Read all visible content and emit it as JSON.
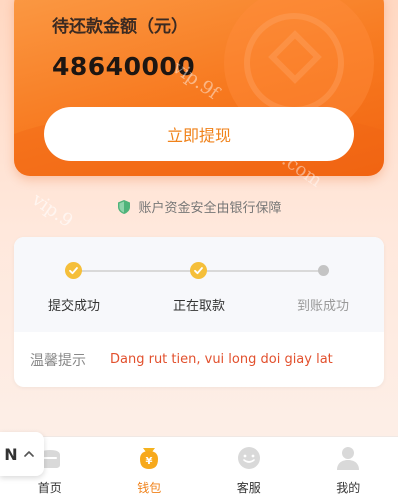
{
  "wallet_card": {
    "balance_label": "待还款金额（元）",
    "balance_value": "48640000",
    "withdraw_button": "立即提现"
  },
  "safety_note": "账户资金安全由银行保障",
  "progress": {
    "steps": [
      {
        "label": "提交成功",
        "status": "done"
      },
      {
        "label": "正在取款",
        "status": "done"
      },
      {
        "label": "到账成功",
        "status": "pending"
      }
    ]
  },
  "tip": {
    "label": "温馨提示",
    "message": "Dang rut tien, vui long doi giay lat"
  },
  "language_chip": {
    "code": "N",
    "icon": "chevron-up-icon"
  },
  "watermark": {
    "text_1": "vip.9f",
    "text_2": "vip.9",
    "text_3": ".com"
  },
  "tabbar": {
    "items": [
      {
        "label": "首页",
        "icon": "home-icon",
        "active": false
      },
      {
        "label": "钱包",
        "icon": "wallet-icon",
        "active": true
      },
      {
        "label": "客服",
        "icon": "customer-service-icon",
        "active": false
      },
      {
        "label": "我的",
        "icon": "user-icon",
        "active": false
      }
    ]
  },
  "colors": {
    "accent": "#f0821a",
    "step_done": "#f5bf3a",
    "tip_text": "#e2502d"
  }
}
